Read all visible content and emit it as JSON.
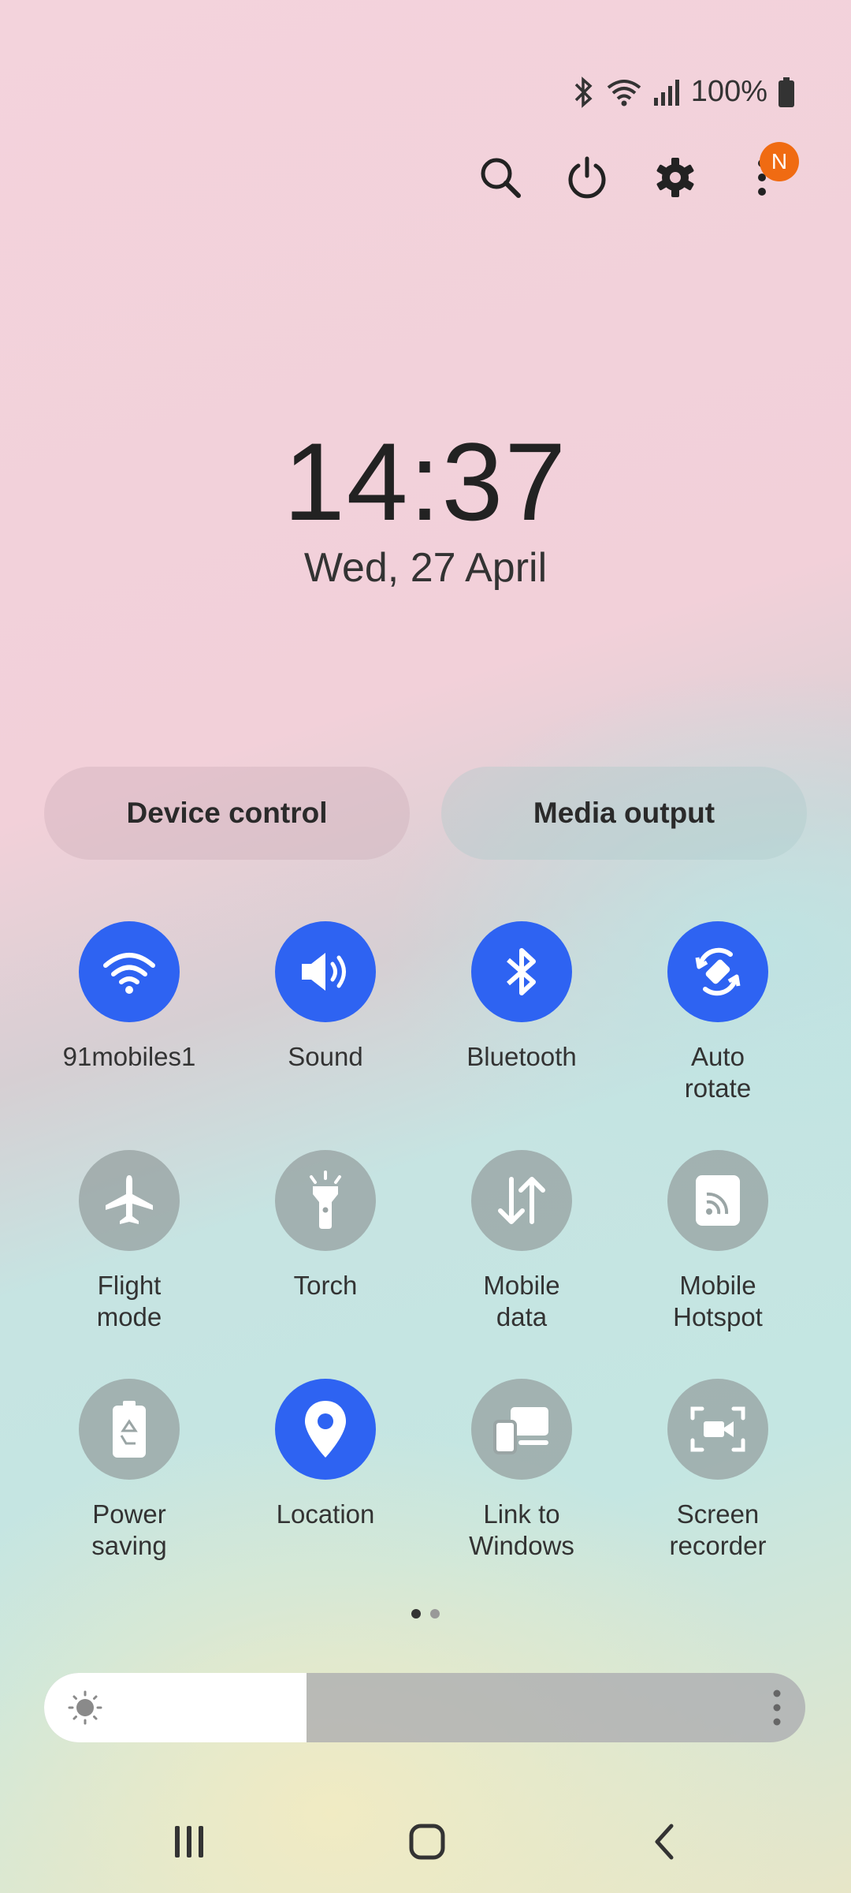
{
  "status_bar": {
    "battery_text": "100%",
    "icons": [
      "bluetooth-icon",
      "wifi-icon",
      "signal-icon",
      "battery-icon"
    ]
  },
  "top_actions": {
    "icons": [
      "search-icon",
      "power-icon",
      "gear-icon",
      "more-icon"
    ],
    "notification_badge": "N"
  },
  "clock": {
    "time": "14:37",
    "date": "Wed, 27 April"
  },
  "pills": {
    "device_control": "Device control",
    "media_output": "Media output"
  },
  "tiles": [
    {
      "label": "91mobiles1",
      "icon": "wifi-icon",
      "state": "on"
    },
    {
      "label": "Sound",
      "icon": "speaker-icon",
      "state": "on"
    },
    {
      "label": "Bluetooth",
      "icon": "bluetooth-icon",
      "state": "on"
    },
    {
      "label": "Auto\nrotate",
      "icon": "auto-rotate-icon",
      "state": "on"
    },
    {
      "label": "Flight\nmode",
      "icon": "airplane-icon",
      "state": "off"
    },
    {
      "label": "Torch",
      "icon": "torch-icon",
      "state": "off"
    },
    {
      "label": "Mobile\ndata",
      "icon": "mobile-data-icon",
      "state": "off"
    },
    {
      "label": "Mobile\nHotspot",
      "icon": "hotspot-icon",
      "state": "off"
    },
    {
      "label": "Power\nsaving",
      "icon": "battery-saver-icon",
      "state": "off"
    },
    {
      "label": "Location",
      "icon": "location-icon",
      "state": "on"
    },
    {
      "label": "Link to\nWindows",
      "icon": "link-to-windows-icon",
      "state": "off"
    },
    {
      "label": "Screen\nrecorder",
      "icon": "screen-recorder-icon",
      "state": "off"
    }
  ],
  "page_indicator": {
    "current": 1,
    "total": 2
  },
  "brightness": {
    "level": 0.345
  },
  "colors": {
    "accent": "#2e63f2",
    "tile_off": "#9aa5a5",
    "badge": "#f06b12"
  },
  "nav_bar": {
    "icons": [
      "recents-icon",
      "home-icon",
      "back-icon"
    ]
  }
}
